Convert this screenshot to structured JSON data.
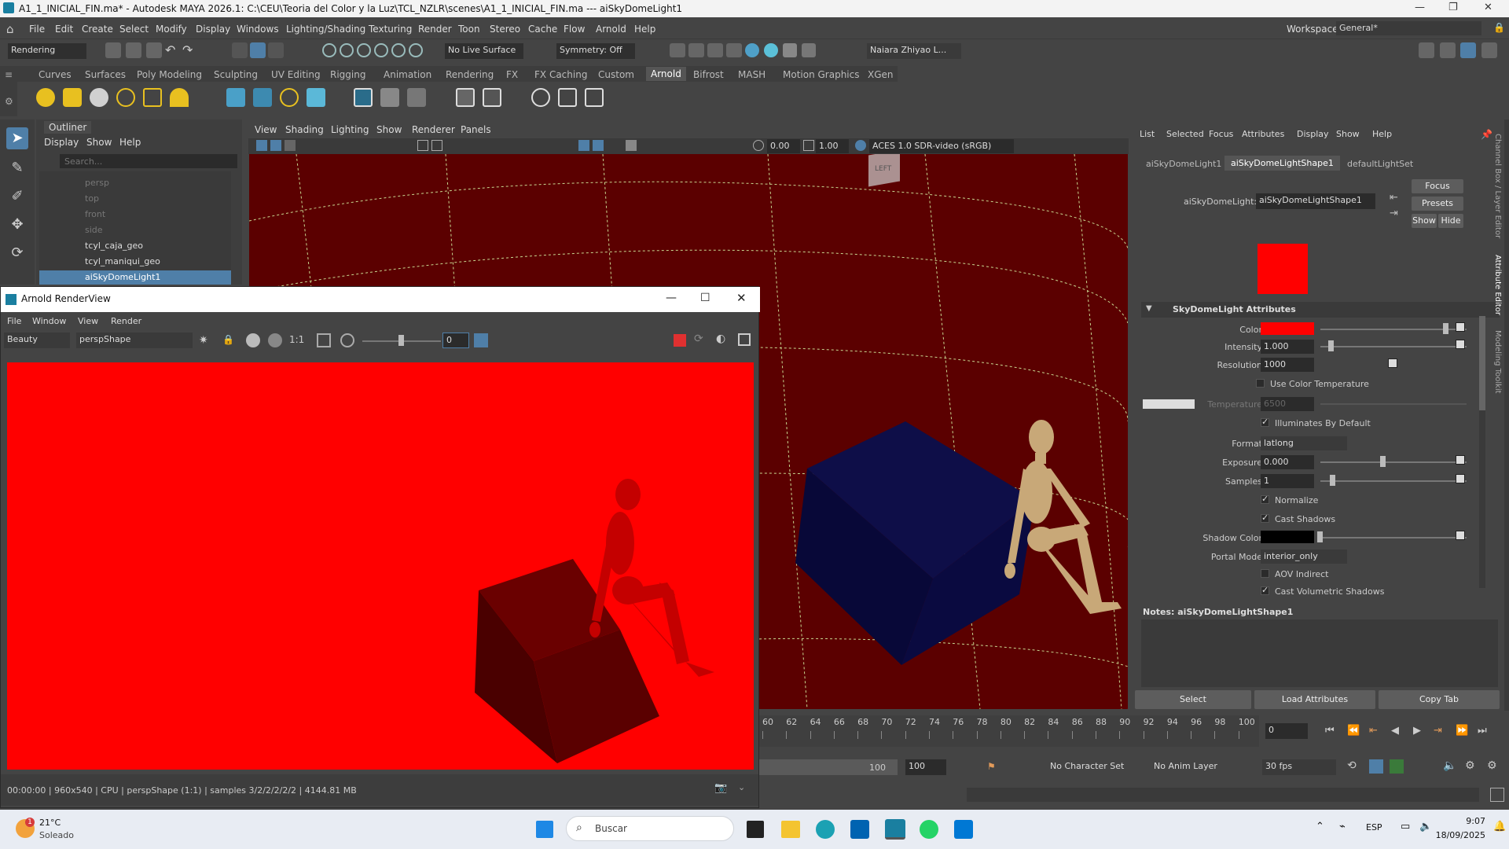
{
  "window": {
    "title": "A1_1_INICIAL_FIN.ma* - Autodesk MAYA 2026.1: C:\\CEU\\Teoria del Color y la Luz\\TCL_NZLR\\scenes\\A1_1_INICIAL_FIN.ma  ---  aiSkyDomeLight1"
  },
  "menu": [
    "File",
    "Edit",
    "Create",
    "Select",
    "Modify",
    "Display",
    "Windows",
    "Lighting/Shading",
    "Texturing",
    "Render",
    "Toon",
    "Stereo",
    "Cache",
    "Flow",
    "Arnold",
    "Help"
  ],
  "workspace": {
    "label": "Workspace:",
    "value": "General*"
  },
  "statusline": {
    "mode": "Rendering",
    "live_surface": "No Live Surface",
    "symmetry": "Symmetry: Off",
    "user": "Naiara Zhiyao L..."
  },
  "shelf_tabs": [
    "Curves",
    "Surfaces",
    "Poly Modeling",
    "Sculpting",
    "UV Editing",
    "Rigging",
    "Animation",
    "Rendering",
    "FX",
    "FX Caching",
    "Custom",
    "Arnold",
    "Bifrost",
    "MASH",
    "Motion Graphics",
    "XGen"
  ],
  "shelf_active": "Arnold",
  "outliner": {
    "title": "Outliner",
    "menu": [
      "Display",
      "Show",
      "Help"
    ],
    "search_placeholder": "Search...",
    "items": [
      "persp",
      "top",
      "front",
      "side",
      "tcyl_caja_geo",
      "tcyl_maniqui_geo",
      "aiSkyDomeLight1"
    ],
    "selected": "aiSkyDomeLight1"
  },
  "viewport": {
    "menu": [
      "View",
      "Shading",
      "Lighting",
      "Show",
      "Renderer",
      "Panels"
    ],
    "exposure": "0.00",
    "gamma": "1.00",
    "color_space": "ACES 1.0 SDR-video (sRGB)",
    "viewcube_label": "LEFT"
  },
  "attribute_editor": {
    "menu": [
      "List",
      "Selected",
      "Focus",
      "Attributes",
      "Display",
      "Show",
      "Help"
    ],
    "tabs": [
      "aiSkyDomeLight1",
      "aiSkyDomeLightShape1",
      "defaultLightSet"
    ],
    "active_tab": "aiSkyDomeLightShape1",
    "node_label": "aiSkyDomeLight:",
    "node_value": "aiSkyDomeLightShape1",
    "buttons": {
      "focus": "Focus",
      "presets": "Presets",
      "show": "Show",
      "hide": "Hide"
    },
    "section": "SkyDomeLight Attributes",
    "color": {
      "label": "Color",
      "value": "#ff0000"
    },
    "intensity": {
      "label": "Intensity",
      "value": "1.000"
    },
    "resolution": {
      "label": "Resolution",
      "value": "1000"
    },
    "use_color_temperature": "Use Color Temperature",
    "temperature": {
      "label": "Temperature",
      "value": "6500"
    },
    "illuminates_by_default": "Illuminates By Default",
    "format": {
      "label": "Format",
      "value": "latlong"
    },
    "exposure": {
      "label": "Exposure",
      "value": "0.000"
    },
    "samples": {
      "label": "Samples",
      "value": "1"
    },
    "normalize": "Normalize",
    "cast_shadows": "Cast Shadows",
    "shadow_color": {
      "label": "Shadow Color",
      "value": "#000000"
    },
    "portal_mode": {
      "label": "Portal Mode",
      "value": "interior_only"
    },
    "aov_indirect": "AOV Indirect",
    "cast_volumetric_shadows": "Cast Volumetric Shadows",
    "notes_label": "Notes:  aiSkyDomeLightShape1",
    "bottom_buttons": [
      "Select",
      "Load Attributes",
      "Copy Tab"
    ],
    "side_tabs": [
      "Channel Box / Layer Editor",
      "Attribute Editor",
      "Modeling Toolkit"
    ]
  },
  "render_view": {
    "title": "Arnold RenderView",
    "menu": [
      "File",
      "Window",
      "View",
      "Render"
    ],
    "aov": "Beauty",
    "camera": "perspShape",
    "ratio": "1:1",
    "frame_field": "0",
    "status": "00:00:00 | 960x540 | CPU | perspShape (1:1) | samples 3/2/2/2/2/2 | 4144.81 MB"
  },
  "timeline": {
    "ticks": [
      "60",
      "62",
      "64",
      "66",
      "68",
      "70",
      "72",
      "74",
      "76",
      "78",
      "80",
      "82",
      "84",
      "86",
      "88",
      "90",
      "92",
      "94",
      "96",
      "98",
      "100"
    ],
    "current_frame": "0",
    "range_end_a": "100",
    "range_end_b": "100",
    "character_set": "No Character Set",
    "anim_layer": "No Anim Layer",
    "fps": "30 fps"
  },
  "taskbar": {
    "weather_temp": "21°C",
    "weather_desc": "Soleado",
    "weather_badge": "1",
    "search": "Buscar",
    "lang": "ESP",
    "time": "9:07",
    "date": "18/09/2025"
  },
  "colors": {
    "render_bg": "#ff0000",
    "viewport_bg": "#5b0000",
    "accent": "#4f7fa8"
  }
}
